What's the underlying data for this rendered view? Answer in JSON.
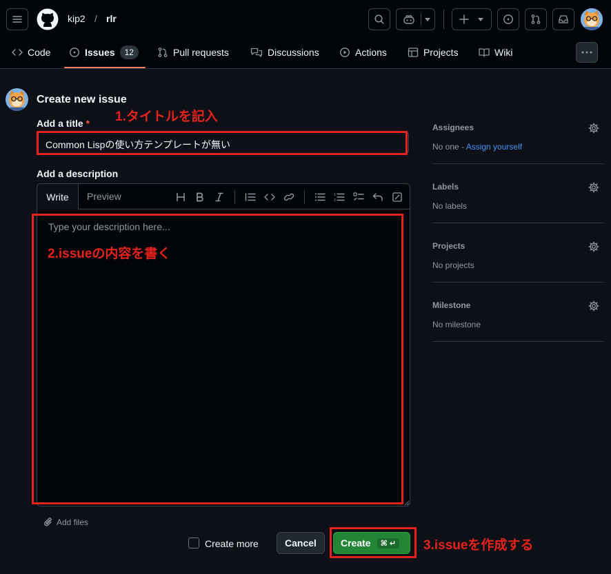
{
  "header": {
    "owner": "kip2",
    "separator": "/",
    "repo": "rlr"
  },
  "nav": {
    "tabs": [
      {
        "label": "Code",
        "icon": "code-icon"
      },
      {
        "label": "Issues",
        "icon": "issue-opened-icon",
        "count": "12",
        "selected": true
      },
      {
        "label": "Pull requests",
        "icon": "git-pull-request-icon"
      },
      {
        "label": "Discussions",
        "icon": "comment-discussion-icon"
      },
      {
        "label": "Actions",
        "icon": "play-icon"
      },
      {
        "label": "Projects",
        "icon": "table-icon"
      },
      {
        "label": "Wiki",
        "icon": "book-icon"
      }
    ]
  },
  "form": {
    "page_title": "Create new issue",
    "title_label": "Add a title",
    "required_mark": "*",
    "title_value": "Common Lispの使い方テンプレートが無い",
    "description_label": "Add a description",
    "write_tab": "Write",
    "preview_tab": "Preview",
    "description_placeholder": "Type your description here...",
    "add_files": "Add files",
    "create_more": "Create more",
    "cancel": "Cancel",
    "create": "Create",
    "create_shortcut": "⌘ ↵"
  },
  "annotations": {
    "step1": "1.タイトルを記入",
    "step2": "2.issueの内容を書く",
    "step3": "3.issueを作成する",
    "color": "#e5231b"
  },
  "sidebar": {
    "assignees": {
      "heading": "Assignees",
      "value": "No one - ",
      "link": "Assign yourself"
    },
    "labels": {
      "heading": "Labels",
      "value": "No labels"
    },
    "projects": {
      "heading": "Projects",
      "value": "No projects"
    },
    "milestone": {
      "heading": "Milestone",
      "value": "No milestone"
    }
  },
  "colors": {
    "background": "#0d1117",
    "header_bg": "#010409",
    "accent_underline": "#f78166",
    "create_button": "#238636",
    "link": "#4493f8"
  }
}
